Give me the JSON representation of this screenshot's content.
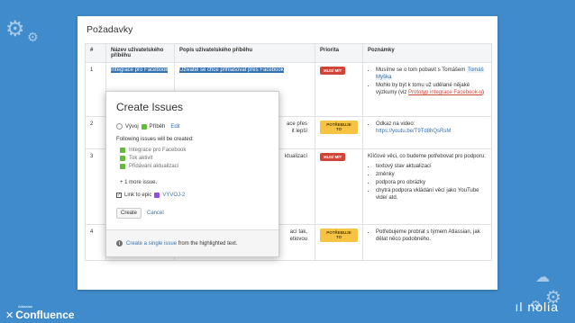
{
  "page": {
    "heading": "Požadavky"
  },
  "table": {
    "headers": [
      "#",
      "Název uživatelského příběhu",
      "Popis uživatelského příběhu",
      "Priorita",
      "Poznámky"
    ],
    "rows": [
      {
        "num": "1",
        "title": "Integrace pro Facebook",
        "description": "Uživatel se chce přihlašovat přes Facebook",
        "priority": "MUSÍ MÍT",
        "notes": [
          "Musíme se o tom pobavit s Tomášem",
          "Tomáš Myška",
          "Mohlo by být k tomu už udělané nějaké výzkumy (viz ",
          "Prototyp integrace Facebook-u",
          ")"
        ]
      },
      {
        "num": "2",
        "title": "",
        "description_fragments": [
          "ace přes",
          "it lepší"
        ],
        "priority": "POTŘEBUJE TO",
        "note_label": "Odkaz na video: ",
        "note_link": "https://youtu.be/T9Td8hQsRsM"
      },
      {
        "num": "3",
        "title": "",
        "description_fragment": "ktualizací",
        "priority": "MUSÍ MÍT",
        "notes_intro": "Klíčové věci, co budeme potřebovat pro podporu:",
        "notes": [
          "textový stav aktualizací",
          "změnky",
          "podpora pro obrázky",
          "chytrá podpora vkládání věcí jako YouTube videí atd."
        ]
      },
      {
        "num": "4",
        "title": "",
        "description_fragments": [
          "ací tak,",
          "etiovou",
          "stránku"
        ],
        "priority": "POTŘEBUJE TO",
        "notes": [
          "Potřebujeme probrat s týmem Atlassian, jak dělat něco podobného."
        ]
      }
    ]
  },
  "popup": {
    "title": "Create Issues",
    "project": "Vývoj",
    "issue_type": "Příběh",
    "edit_label": "Edit",
    "following_text": "Following issues will be created:",
    "issues": [
      "Integrace pro Facebook",
      "Tok aktivit",
      "Přidávání aktualizací"
    ],
    "more_text": "+ 1 more issue.",
    "epic_label": "Link to epic",
    "epic_key": "VYVOJ-2",
    "epic_checked": "✓",
    "create_label": "Create",
    "cancel_label": "Cancel",
    "footer_link": "Create a single issue",
    "footer_rest": " from the highlighted text."
  },
  "branding": {
    "small_text": "Atlassian",
    "product": "Confluence",
    "company": "ıl nolia"
  },
  "colors": {
    "background": "#3f8bcb",
    "must_have": "#d04437",
    "needs_it": "#f6c342",
    "link": "#3572b0"
  }
}
